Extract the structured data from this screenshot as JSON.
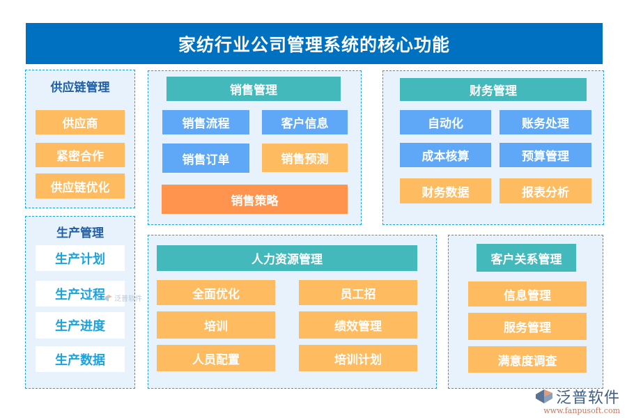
{
  "title": "家纺行业公司管理系统的核心功能",
  "supply_chain": {
    "label": "供应链管理",
    "items": [
      "供应商",
      "紧密合作",
      "供应链优化"
    ]
  },
  "production": {
    "label": "生产管理",
    "items": [
      "生产计划",
      "生产过程",
      "生产进度",
      "生产数据"
    ]
  },
  "sales": {
    "header": "销售管理",
    "items": [
      "销售流程",
      "客户信息",
      "销售订单",
      "销售预测"
    ],
    "footer": "销售策略"
  },
  "finance": {
    "header": "财务管理",
    "items": [
      "自动化",
      "账务处理",
      "成本核算",
      "预算管理",
      "财务数据",
      "报表分析"
    ]
  },
  "hr": {
    "header": "人力资源管理",
    "items": [
      "全面优化",
      "员工招",
      "培训",
      "绩效管理",
      "人员配置",
      "培训计划"
    ]
  },
  "crm": {
    "header": "客户关系管理",
    "items": [
      "信息管理",
      "服务管理",
      "满意度调查"
    ]
  },
  "branding": {
    "logo_text": "泛普软件",
    "logo_url": "www.fanpusoft.com",
    "watermark_text": "泛普软件"
  },
  "colors": {
    "title_bg": "#0070c0",
    "teal": "#43b9bb",
    "blue": "#5fa8f8",
    "amber": "#ffbb5f",
    "orange": "#ff944f",
    "panel_bg": "#e8f2fc",
    "panel_border": "#1aa3d8"
  }
}
